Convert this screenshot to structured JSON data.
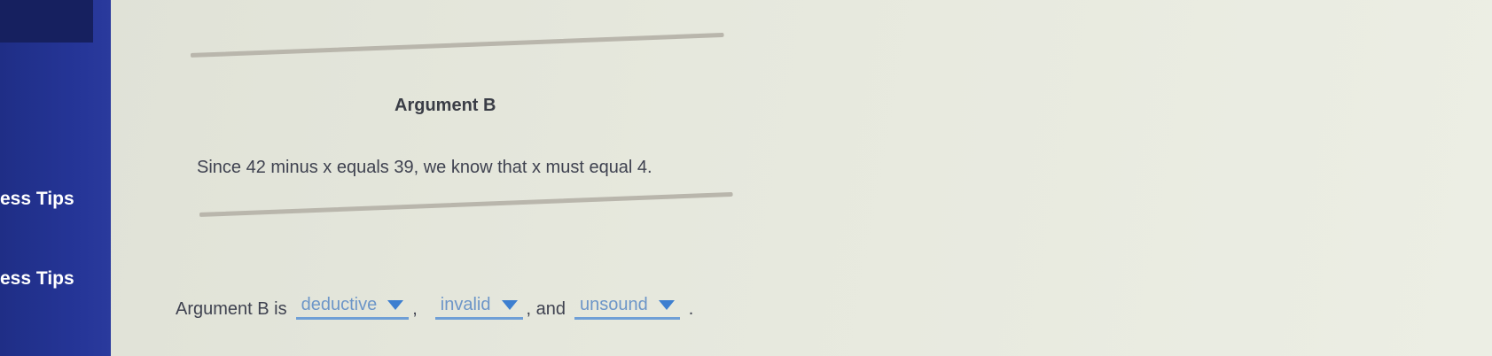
{
  "sidebar": {
    "items": [
      {
        "label": "ess Tips"
      },
      {
        "label": "ess Tips"
      }
    ]
  },
  "argument": {
    "title": "Argument B",
    "text": "Since 42 minus x equals 39, we know that x must equal 4."
  },
  "answer": {
    "prefix": "Argument B is",
    "sep1": ",",
    "sep2": ", and",
    "end": ".",
    "dropdowns": [
      {
        "selected": "deductive"
      },
      {
        "selected": "invalid"
      },
      {
        "selected": "unsound"
      }
    ]
  },
  "colors": {
    "sidebar": "#253597",
    "dropdown_text": "#6d96c8",
    "dropdown_caret": "#3d7fd0"
  }
}
